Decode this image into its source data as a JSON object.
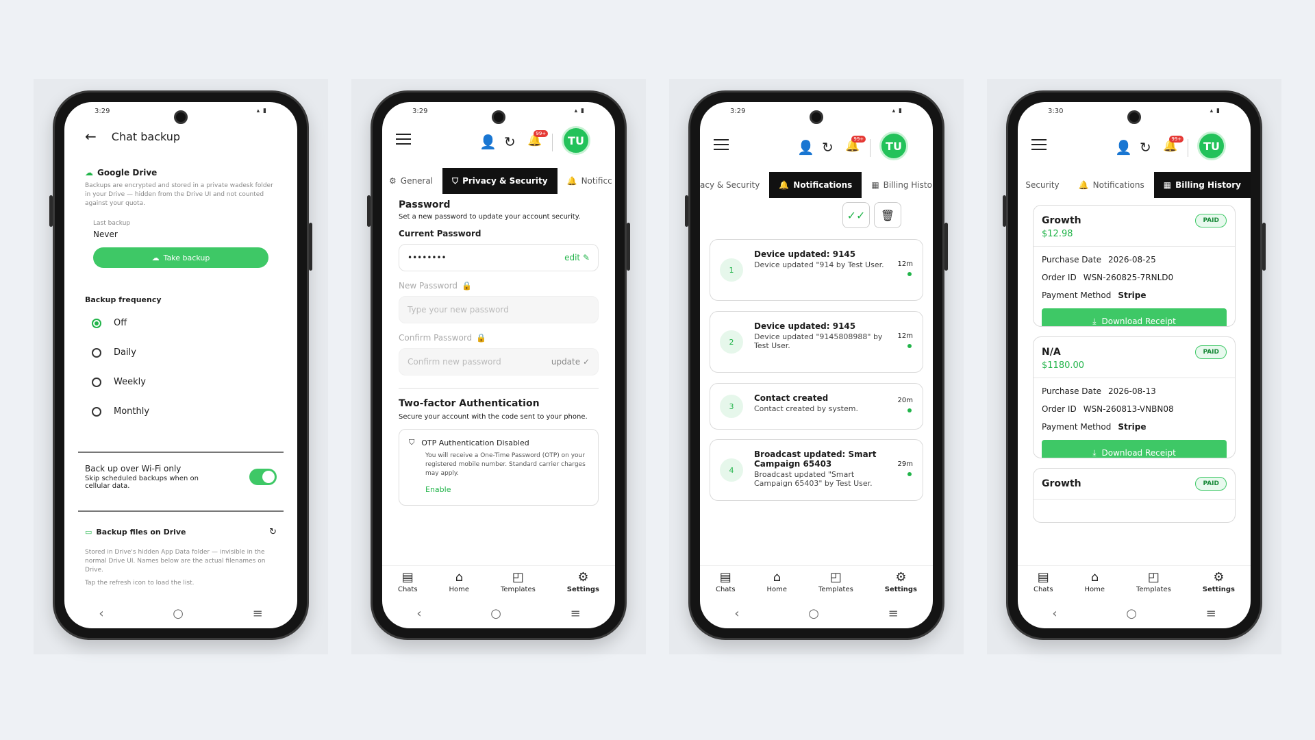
{
  "phone1": {
    "time": "3:29",
    "title": "Chat backup",
    "drive_title": "Google Drive",
    "drive_desc": "Backups are encrypted and stored in a private wadesk folder in your Drive — hidden from the Drive UI and not counted against your quota.",
    "last_backup_label": "Last backup",
    "last_backup_value": "Never",
    "take_backup": "Take backup",
    "frequency_title": "Backup frequency",
    "options": [
      "Off",
      "Daily",
      "Weekly",
      "Monthly"
    ],
    "selected_option": "Off",
    "wifi_title": "Back up over Wi-Fi only",
    "wifi_desc": "Skip scheduled backups when on cellular data.",
    "wifi_on": true,
    "files_title": "Backup files on Drive",
    "files_desc": "Stored in Drive's hidden App Data folder — invisible in the normal Drive UI. Names below are the actual filenames on Drive.",
    "files_hint": "Tap the refresh icon to load the list."
  },
  "phone2": {
    "time": "3:29",
    "avatar": "TU",
    "badge": "99+",
    "tabs": [
      "General",
      "Privacy & Security",
      "Notificc"
    ],
    "password_title": "Password",
    "password_desc": "Set a new password to update your account security.",
    "current_label": "Current Password",
    "current_value": "••••••••",
    "edit": "edit",
    "new_label": "New Password",
    "new_placeholder": "Type your new password",
    "confirm_label": "Confirm Password",
    "confirm_placeholder": "Confirm new password",
    "update": "update",
    "tfa_title": "Two-factor Authentication",
    "tfa_desc": "Secure your account with the code sent to your phone.",
    "otp_title": "OTP Authentication Disabled",
    "otp_desc": "You will receive a One-Time Password (OTP) on your registered mobile number. Standard carrier charges may apply.",
    "enable": "Enable"
  },
  "phone3": {
    "time": "3:29",
    "avatar": "TU",
    "badge": "99+",
    "tabs": [
      "acy & Security",
      "Notifications",
      "Billing Histo"
    ],
    "notifications": [
      {
        "n": "1",
        "title": "Device updated: 9145",
        "body": "Device updated \"914 by Test User.",
        "time": "12m"
      },
      {
        "n": "2",
        "title": "Device updated: 9145",
        "body": "Device updated \"9145808988\" by Test User.",
        "time": "12m"
      },
      {
        "n": "3",
        "title": "Contact created",
        "body": "Contact created by system.",
        "time": "20m"
      },
      {
        "n": "4",
        "title": "Broadcast updated: Smart Campaign 65403",
        "body": "Broadcast updated \"Smart Campaign 65403\" by Test User.",
        "time": "29m"
      }
    ]
  },
  "phone4": {
    "time": "3:30",
    "avatar": "TU",
    "badge": "99+",
    "tabs": [
      "Security",
      "Notifications",
      "Billing History"
    ],
    "purchase_label": "Purchase Date",
    "order_label": "Order ID",
    "payment_label": "Payment Method",
    "download": "Download Receipt",
    "bills": [
      {
        "plan": "Growth",
        "status": "PAID",
        "amount": "$12.98",
        "date": "2026-08-25",
        "order": "WSN-260825-7RNLD0",
        "method": "Stripe"
      },
      {
        "plan": "N/A",
        "status": "PAID",
        "amount": "$1180.00",
        "date": "2026-08-13",
        "order": "WSN-260813-VNBN08",
        "method": "Stripe"
      },
      {
        "plan": "Growth",
        "status": "PAID"
      }
    ]
  },
  "bottom_nav": [
    "Chats",
    "Home",
    "Templates",
    "Settings"
  ],
  "colors": {
    "accent": "#3ec866",
    "dark": "#111111"
  }
}
